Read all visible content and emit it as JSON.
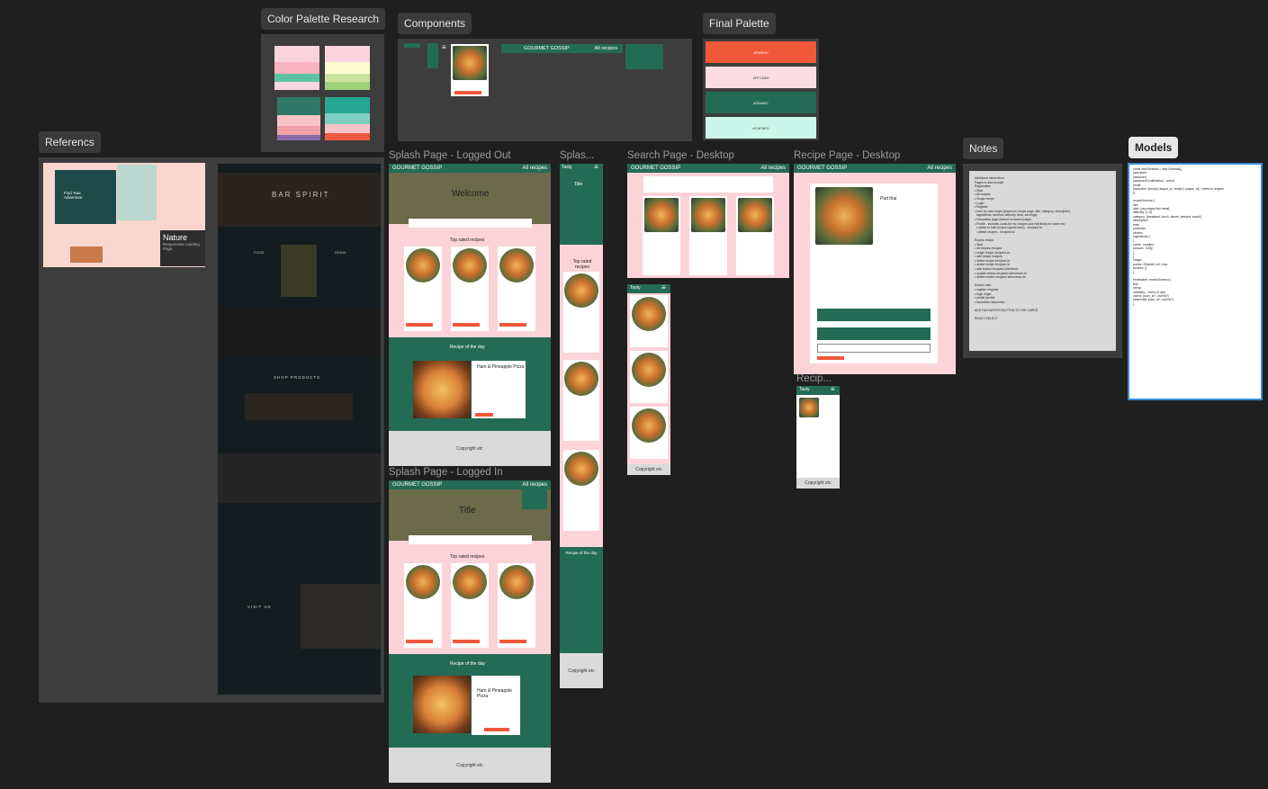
{
  "pills": {
    "color_palette": "Color Palette Research",
    "components": "Components",
    "final_palette": "Final Palette",
    "references": "Referencs",
    "notes": "Notes",
    "models": "Models"
  },
  "frames": {
    "splash_out": "Splash Page - Logged Out",
    "splash_mobile": "Splas...",
    "search_desktop": "Search Page - Desktop",
    "recipe_desktop": "Recipe Page - Desktop",
    "splash_in": "Splash Page - Logged In",
    "recipe_mobile": "Recip..."
  },
  "final_palette": [
    {
      "hex": "#F05E40",
      "color": "#f0583a"
    },
    {
      "hex": "#FFCDE0",
      "color": "#fbdde3"
    },
    {
      "hex": "#2D6A57",
      "color": "#246b55"
    },
    {
      "hex": "#CAFAED",
      "color": "#cbf7ea"
    }
  ],
  "site": {
    "brand": "GOURMET GOSSIP",
    "all_recipes": "All recipes",
    "welcome": "Welcome",
    "title": "Title",
    "top_rated": "Top rated recipes",
    "recipe_of_day": "Recipe of the day",
    "copyright": "Copyright etc",
    "dish": "Pad thai",
    "pizza": "Ham & Pineapple Pizza",
    "mobile_brand": "Tasty",
    "mobile_top_rated": "Top rated recipes",
    "mobile_recipe_day": "Recipe of the day"
  },
  "references": {
    "nature_title": "Nature",
    "nature_sub": "Responsive Landing Page",
    "find_adventure": "Find Your Adventure",
    "bar_title": "BAR SPIRIT",
    "food": "FOOD",
    "drink": "DRINK",
    "shop": "SHOP PRODUCTS",
    "visit": "VISIT US"
  },
  "notes": {
    "lines": [
      "Additional information",
      "Pages to also include",
      "Registration",
      "• Start",
      "• All recipes",
      "• Single recipe",
      "• Login",
      "• Register",
      "• form for new recipe (based on recipe page, title, category, description,",
      "  ingredients, method, difficulty, time, servings)",
      "• Favourites page (based on search page)",
      "• Profile - includes cards for my recipes and edit fields for name etc",
      "  • option to edit recipes (opens form) - /recipes/:id",
      "  • delete recipes - /recipes/:id",
      "",
      "Routes recipe",
      "• Start",
      "• all recipes /recipes",
      "• single recipe /recipes/:id",
      "• add recipe /recipes",
      "• delete recipe /recipes/:id",
      "• delete recipe /recipes/:id",
      "• add review /recipes/:id/reviews",
      "• update review /recipes/:id/reviews/:id",
      "• delete review /recipes/:id/reviews/:id",
      "",
      "Routes user",
      "• register /register",
      "• login /login",
      "• profile /profile",
      "• favourites /favourites",
      "",
      "ADD FAVOURITES BUTTON TO THE CARDS",
      "",
      "REACT-SELECT"
    ]
  },
  "models": {
    "lines": [
      "const userSchema = new Schema({",
      "username:",
      "password:",
      "passwordConfirmation - virtual",
      "email:",
      "favourites: [recipe] unique_id, 'recipe') unique_id] - refers to recipes",
      "})",
      "",
      "recipeSchema {",
      "title:",
      "dish: [veg vegan fish meat]",
      "difficulty: [1-5]",
      "category: [breakfast, lunch, dinner, dessert, snack]",
      "description:",
      "time:",
      "workload:",
      "serves:",
      "ingredients: [",
      "{",
      "name: 'noodles',",
      "amount: '100g'",
      "}",
      "]",
      "image:",
      "author: ObjectID ref: User",
      "reviews: []",
      "}",
      "",
      "embedded: reviewSchema {",
      "text:",
      "rating:",
      "addedBy - refers to user",
      "userId: [user_id?, userId?]",
      "downvoter [user_id?, userId?]",
      "}"
    ]
  }
}
